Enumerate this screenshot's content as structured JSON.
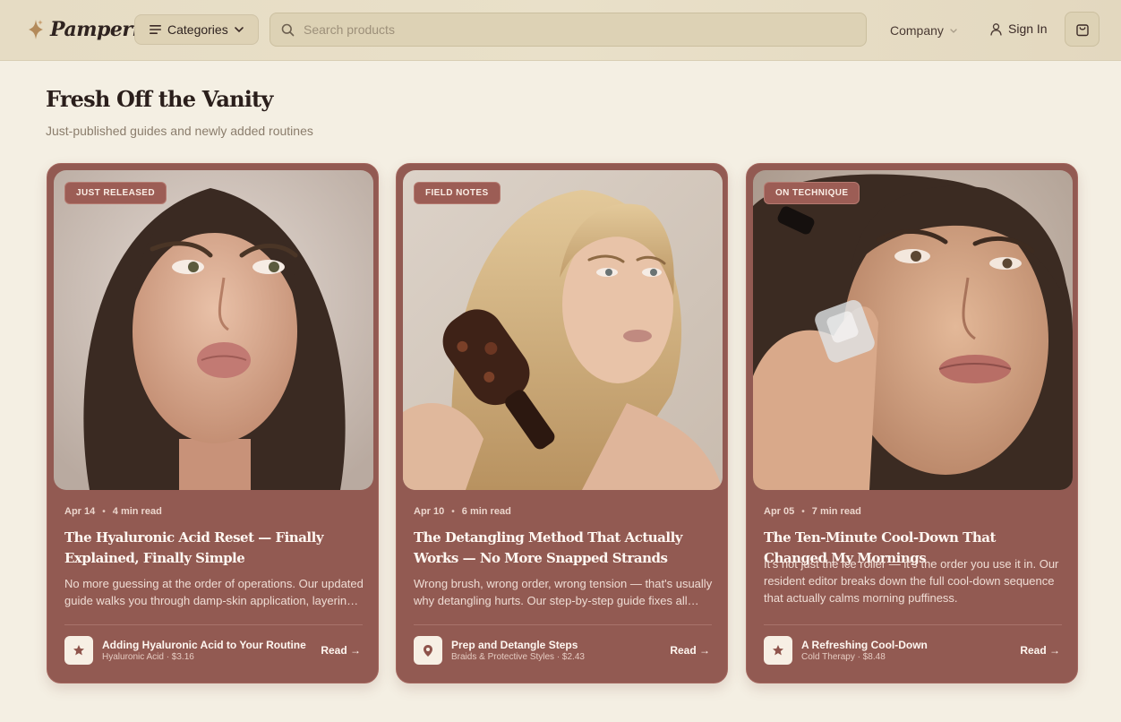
{
  "header": {
    "brand": "Pamperng",
    "categories_label": "Categories",
    "search_placeholder": "Search products",
    "company_label": "Company",
    "signin_label": "Sign In"
  },
  "section": {
    "title": "Fresh Off the Vanity",
    "subtitle": "Just-published guides and newly added routines"
  },
  "cards": [
    {
      "tag": "JUST RELEASED",
      "date": "Apr 14",
      "read_time": "4 min read",
      "title": "The Hyaluronic Acid Reset — Finally Explained, Finally Simple",
      "description": "No more guessing at the order of operations. Our updated guide walks you through damp-skin application, layering and sealing.",
      "product_icon": "star-icon",
      "product_name": "Adding Hyaluronic Acid to Your Routine",
      "product_meta": "Hyaluronic Acid · $3.16",
      "read_label": "Read →"
    },
    {
      "tag": "FIELD NOTES",
      "date": "Apr 10",
      "read_time": "6 min read",
      "title": "The Detangling Method That Actually Works — No More Snapped Strands",
      "description": "Wrong brush, wrong order, wrong tension — that's usually why detangling hurts. Our step-by-step guide fixes all three.",
      "product_icon": "map-pin-icon",
      "product_name": "Prep and Detangle Steps",
      "product_meta": "Braids & Protective Styles · $2.43",
      "read_label": "Read →"
    },
    {
      "tag": "ON TECHNIQUE",
      "date": "Apr 05",
      "read_time": "7 min read",
      "title": "The Ten-Minute Cool-Down That Changed My Mornings",
      "description": "It's not just the ice roller — it's the order you use it in. Our resident editor breaks down the full cool-down sequence that actually calms morning puffiness.",
      "product_icon": "star-icon",
      "product_name": "A Refreshing Cool-Down",
      "product_meta": "Cold Therapy · $8.48",
      "read_label": "Read →"
    }
  ],
  "colors": {
    "card": "#925a52",
    "page_bg": "#f4efe3",
    "header_bg": "#e6dcc4"
  }
}
